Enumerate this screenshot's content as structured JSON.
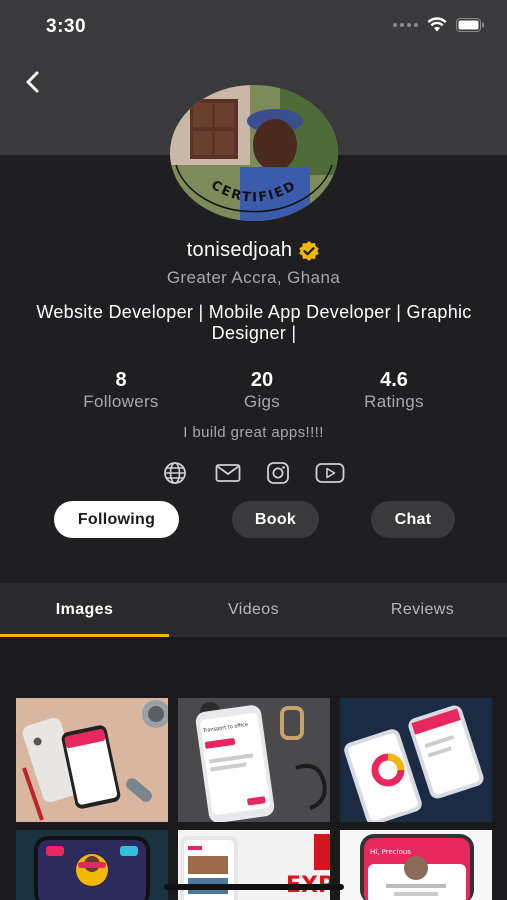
{
  "status_bar": {
    "time": "3:30"
  },
  "profile": {
    "username": "tonisedjoah",
    "avatar_badge_text": "CERTIFIED",
    "location": "Greater Accra, Ghana",
    "headline": "Website Developer | Mobile App Developer | Graphic Designer |",
    "bio": "I build great apps!!!!"
  },
  "stats": [
    {
      "value": "8",
      "label": "Followers"
    },
    {
      "value": "20",
      "label": "Gigs"
    },
    {
      "value": "4.6",
      "label": "Ratings"
    }
  ],
  "social_icons": [
    "globe-icon",
    "mail-icon",
    "instagram-icon",
    "youtube-icon"
  ],
  "actions": {
    "following_label": "Following",
    "book_label": "Book",
    "chat_label": "Chat"
  },
  "tabs": [
    {
      "label": "Images",
      "active": true
    },
    {
      "label": "Videos",
      "active": false
    },
    {
      "label": "Reviews",
      "active": false
    }
  ],
  "thumbnails": {
    "thumb_2_text": "Transport to office",
    "thumb_5_text": "EXP GHA",
    "thumb_6_text": "Hi, Precious"
  },
  "colors": {
    "accent": "#f2b705",
    "verified_badge": "#f2b705",
    "background": "#1e1e20",
    "header_band": "#3a3a3c",
    "pink_ui": "#e8275f"
  }
}
